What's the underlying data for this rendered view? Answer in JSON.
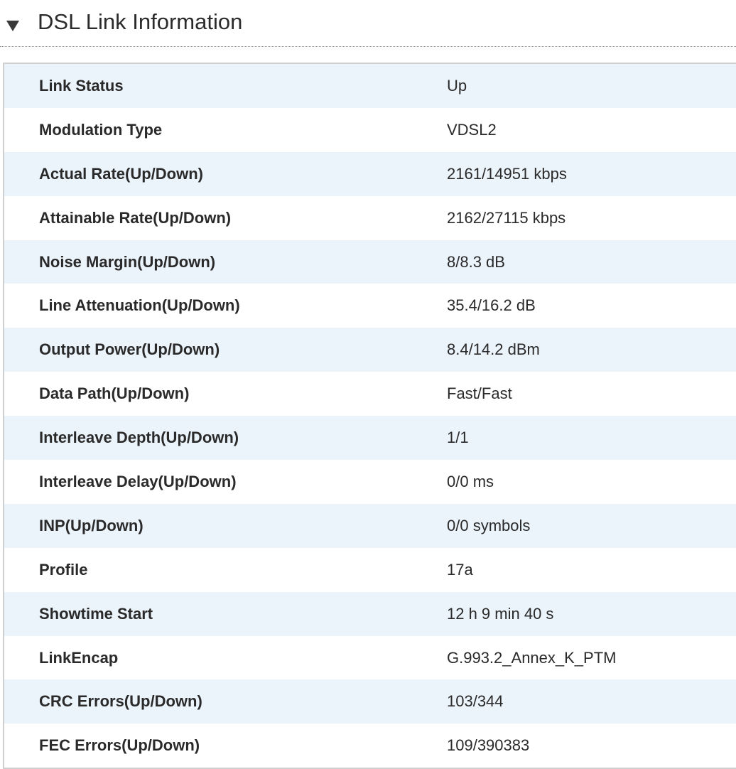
{
  "section": {
    "title": "DSL Link Information"
  },
  "rows": [
    {
      "label": "Link Status",
      "value": "Up"
    },
    {
      "label": "Modulation Type",
      "value": "VDSL2"
    },
    {
      "label": "Actual Rate(Up/Down)",
      "value": "2161/14951 kbps"
    },
    {
      "label": "Attainable Rate(Up/Down)",
      "value": "2162/27115 kbps"
    },
    {
      "label": "Noise Margin(Up/Down)",
      "value": "8/8.3 dB"
    },
    {
      "label": "Line Attenuation(Up/Down)",
      "value": "35.4/16.2 dB"
    },
    {
      "label": "Output Power(Up/Down)",
      "value": "8.4/14.2 dBm"
    },
    {
      "label": "Data Path(Up/Down)",
      "value": "Fast/Fast"
    },
    {
      "label": "Interleave Depth(Up/Down)",
      "value": "1/1"
    },
    {
      "label": "Interleave Delay(Up/Down)",
      "value": "0/0 ms"
    },
    {
      "label": "INP(Up/Down)",
      "value": "0/0 symbols"
    },
    {
      "label": "Profile",
      "value": "17a"
    },
    {
      "label": "Showtime Start",
      "value": "12 h 9 min 40 s"
    },
    {
      "label": "LinkEncap",
      "value": "G.993.2_Annex_K_PTM"
    },
    {
      "label": "CRC Errors(Up/Down)",
      "value": "103/344"
    },
    {
      "label": "FEC Errors(Up/Down)",
      "value": "109/390383"
    }
  ],
  "colors": {
    "row_stripe": "#ebf3fb",
    "row_plain": "#ffffff",
    "border": "#cfcfcf",
    "text": "#2a2a2a"
  }
}
